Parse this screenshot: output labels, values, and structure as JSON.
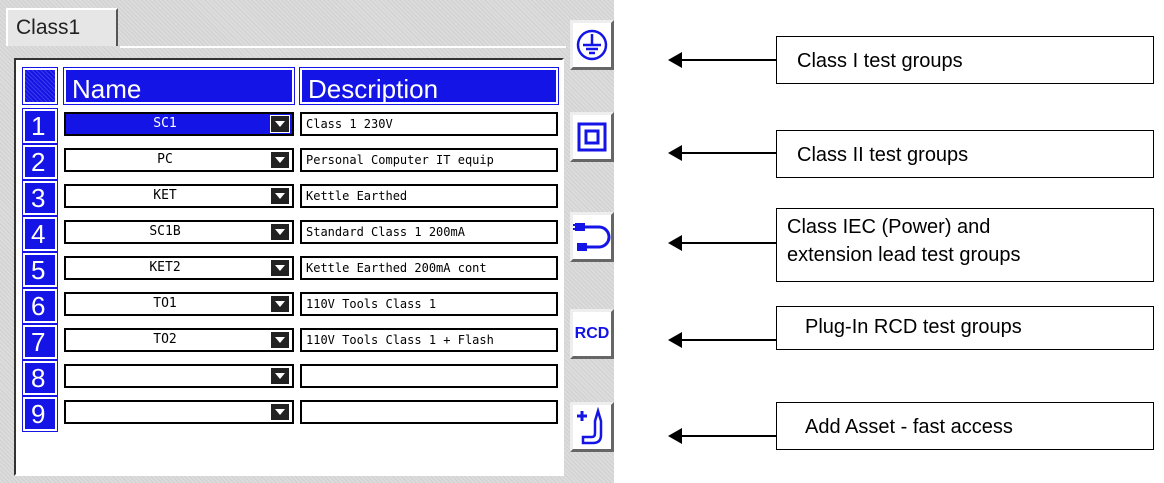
{
  "tab": {
    "label": "Class1"
  },
  "headers": {
    "name": "Name",
    "description": "Description"
  },
  "rows": [
    {
      "num": "1",
      "name": "SC1",
      "description": "Class 1 230V",
      "selected": true
    },
    {
      "num": "2",
      "name": "PC",
      "description": "Personal Computer IT equip",
      "selected": false
    },
    {
      "num": "3",
      "name": "KET",
      "description": "Kettle Earthed",
      "selected": false
    },
    {
      "num": "4",
      "name": "SC1B",
      "description": "Standard Class 1 200mA",
      "selected": false
    },
    {
      "num": "5",
      "name": "KET2",
      "description": "Kettle Earthed 200mA cont",
      "selected": false
    },
    {
      "num": "6",
      "name": "TO1",
      "description": "110V Tools Class 1",
      "selected": false
    },
    {
      "num": "7",
      "name": "TO2",
      "description": "110V Tools Class 1 + Flash",
      "selected": false
    },
    {
      "num": "8",
      "name": "",
      "description": "",
      "selected": false
    },
    {
      "num": "9",
      "name": "",
      "description": "",
      "selected": false
    }
  ],
  "side_buttons": [
    {
      "icon": "earth-ground-icon"
    },
    {
      "icon": "double-square-icon"
    },
    {
      "icon": "plug-lead-icon"
    },
    {
      "icon": "rcd-icon",
      "label": "RCD"
    },
    {
      "icon": "add-asset-icon"
    }
  ],
  "callouts": [
    {
      "line1": "Class I test groups",
      "line2": ""
    },
    {
      "line1": "Class II test groups",
      "line2": ""
    },
    {
      "line1": "Class IEC (Power) and",
      "line2": "extension lead test groups"
    },
    {
      "line1": "Plug-In RCD test groups",
      "line2": ""
    },
    {
      "line1": "Add Asset - fast access",
      "line2": ""
    }
  ],
  "colors": {
    "header_blue": "#1414e6",
    "panel_gray": "#dcdcdc"
  }
}
